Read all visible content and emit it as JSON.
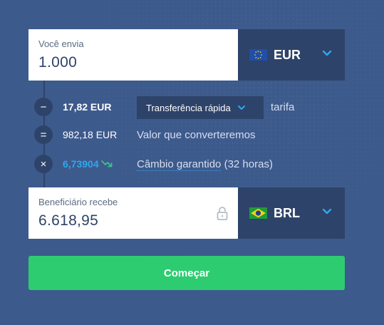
{
  "send": {
    "label": "Você envia",
    "amount": "1.000",
    "currency": "EUR",
    "flag": "eu-flag-icon"
  },
  "fee": {
    "symbol": "−",
    "amount": "17,82 EUR",
    "method": "Transferência rápida",
    "suffix": "tarifa"
  },
  "converted": {
    "symbol": "=",
    "amount": "982,18 EUR",
    "description": "Valor que converteremos"
  },
  "rate": {
    "symbol": "×",
    "value": "6,73904",
    "trend_icon": "trend-down-icon",
    "link_text": "Câmbio garantido",
    "suffix": " (32 horas)"
  },
  "receive": {
    "label": "Beneficiário recebe",
    "amount": "6.618,95",
    "currency": "BRL",
    "flag": "br-flag-icon"
  },
  "cta": {
    "label": "Começar"
  },
  "colors": {
    "background": "#3d5a8c",
    "panel_dark": "#2e4369",
    "accent_blue": "#2ea7f0",
    "cta_green": "#2ecc71"
  }
}
